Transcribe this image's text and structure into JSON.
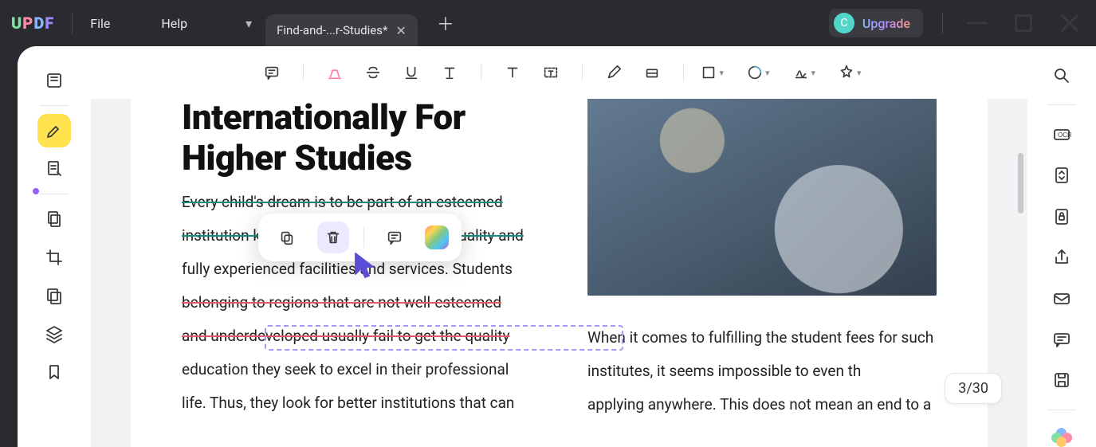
{
  "titlebar": {
    "menu_file": "File",
    "menu_help": "Help",
    "tab_title": "Find-and-...r-Studies*",
    "upgrade_label": "Upgrade",
    "avatar_letter": "C"
  },
  "left_sidebar": {
    "items": [
      {
        "name": "reader-mode-icon"
      },
      {
        "name": "highlight-tool-icon"
      },
      {
        "name": "edit-pdf-icon"
      },
      {
        "name": "page-tools-icon"
      },
      {
        "name": "crop-icon"
      },
      {
        "name": "pages-icon"
      },
      {
        "name": "layers-icon"
      },
      {
        "name": "bookmark-icon"
      }
    ]
  },
  "right_sidebar": {
    "items": [
      {
        "name": "search-icon"
      },
      {
        "name": "ocr-icon",
        "label": "OCR"
      },
      {
        "name": "convert-icon"
      },
      {
        "name": "protect-icon"
      },
      {
        "name": "share-icon"
      },
      {
        "name": "email-icon"
      },
      {
        "name": "comment-icon"
      },
      {
        "name": "save-icon"
      },
      {
        "name": "updf-ai-icon"
      }
    ]
  },
  "toolbar": {
    "items": [
      "note-icon",
      "highlighter-icon",
      "strikethrough-icon",
      "underline-icon",
      "text-markup-icon",
      "text-icon",
      "text-box-icon",
      "pencil-icon",
      "eraser-icon",
      "rectangle-icon",
      "stamp-icon",
      "signature-icon",
      "sticker-icon"
    ]
  },
  "popup": {
    "copy": "copy",
    "delete": "delete",
    "note": "note",
    "color": "color"
  },
  "document": {
    "heading_line1": "Internationally For",
    "heading_line2": "Higher Studies",
    "para_left_1": "Every child's dream is to be part of an esteemed",
    "para_left_2": "institution known worldwide for its high-quality and",
    "para_left_3": "fully experienced facilities and services. Students",
    "para_left_4": "belonging to regions that are not well-esteemed",
    "para_left_5": "and underdeveloped usually fail to get the quality",
    "para_left_6": "education they seek to excel in their professional",
    "para_left_7": "life. Thus, they look for better institutions that can",
    "para_right_1": "When it comes to fulfilling the student fees for such",
    "para_right_2": "institutes, it seems impossible to even th",
    "para_right_3": "applying anywhere. This does not mean an end to a"
  },
  "page_indicator": "3/30"
}
